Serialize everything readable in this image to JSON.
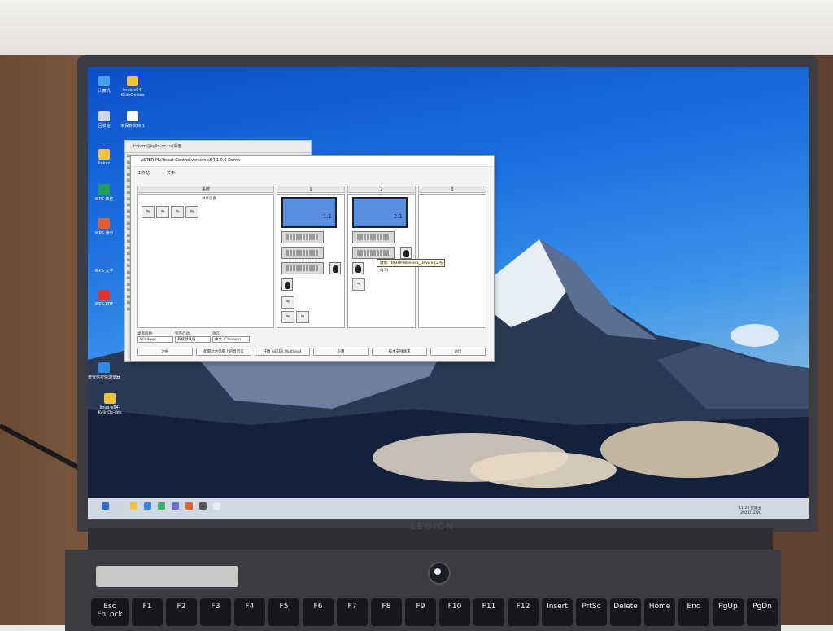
{
  "desktop": {
    "icons": [
      {
        "label": "计算机",
        "icon": "computer-icon",
        "color": "#4aa0e8"
      },
      {
        "label": "linux-x64-KylinOs-des",
        "icon": "folder-icon",
        "color": "#f3c23a"
      },
      {
        "label": "回收站",
        "icon": "trash-icon",
        "color": "#cfd8e0"
      },
      {
        "label": "未保存文档 1",
        "icon": "document-icon",
        "color": "#ffffff"
      },
      {
        "label": "linkvc",
        "icon": "folder-icon",
        "color": "#f3c23a"
      },
      {
        "label": "WPS 表格",
        "icon": "wps-sheet-icon",
        "color": "#1fa05a"
      },
      {
        "label": "WPS 演示",
        "icon": "wps-slides-icon",
        "color": "#e7602b"
      },
      {
        "label": "WPS 文字",
        "icon": "wps-writer-icon",
        "color": "#2a6de0"
      },
      {
        "label": "WPS PDF",
        "icon": "wps-pdf-icon",
        "color": "#e2342d"
      },
      {
        "label": "奇安信可信浏览器",
        "icon": "browser-icon",
        "color": "#2d8ae6"
      },
      {
        "label": "linux-x64-KylinOs-des",
        "icon": "folder-icon",
        "color": "#f3c23a"
      }
    ]
  },
  "terminal": {
    "title": "lizkcm@kylin-pc: ~/桌面",
    "lines": [
      "Deb",
      "Deb",
      "Deb",
      "Deb",
      "Deb",
      "Deb",
      "Deb",
      "Deb",
      "Deb",
      "Deb",
      "Deb",
      "Deb",
      "Deb",
      "Deb",
      "Deb",
      "Deb",
      "Deb",
      "Deb",
      "Deb",
      "Deb",
      "Deb",
      "Deb",
      "Deb",
      "Deb",
      "Deb",
      "Deb"
    ]
  },
  "aster": {
    "title": "ASTER Multiseat Control version x64 1.0.6 Demo",
    "tabs": [
      "工作站",
      "关于"
    ],
    "columns": {
      "system": "系统",
      "ws1": "1",
      "ws2": "2",
      "ws3": "3"
    },
    "shared_devices_label": "共享设备",
    "monitor1_label": "1.1",
    "monitor2_label": "2.1",
    "tooltip": "键盘: \"RCHIP Wireless_Device (工作站 2)",
    "settings": {
      "login_mode_label": "桌面风格:",
      "login_mode_value": "Windows",
      "startup_label": "程序启动:",
      "startup_value": "系统默认值",
      "language_label": "语言:",
      "language_value": "中文 (Chinese)"
    },
    "buttons": [
      "注册",
      "配置此台电脑上的显示信",
      "开始 ASTER Multiseat",
      "应用",
      "技术支持请求",
      "退出"
    ]
  },
  "taskbar": {
    "clock_time": "11:24 星期五",
    "clock_date": "2024/12/20"
  },
  "laptop": {
    "brand": "LEGION",
    "keys": [
      "Esc FnLock",
      "F1",
      "F2",
      "F3",
      "F4",
      "F5",
      "F6",
      "F7",
      "F8",
      "F9",
      "F10",
      "F11",
      "F12",
      "Insert",
      "PrtSc",
      "Delete",
      "Home",
      "End",
      "PgUp",
      "PgDn"
    ]
  }
}
